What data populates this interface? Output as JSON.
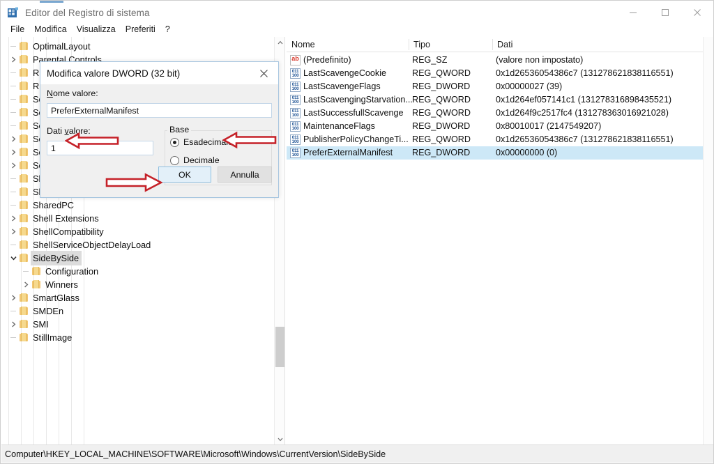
{
  "window": {
    "title": "Editor del Registro di sistema",
    "app_icon": "registry-editor-icon",
    "minimize_label": "Riduci a icona",
    "maximize_label": "Ingrandisci",
    "close_label": "Chiudi"
  },
  "menubar": {
    "items": [
      {
        "label": "File"
      },
      {
        "label": "Modifica"
      },
      {
        "label": "Visualizza"
      },
      {
        "label": "Preferiti"
      },
      {
        "label": "?"
      }
    ]
  },
  "tree": {
    "nodes": [
      {
        "label": "OptimalLayout",
        "depth": 6,
        "expander": "none",
        "selected": false
      },
      {
        "label": "Parental Controls",
        "depth": 6,
        "expander": "collapsed",
        "selected": false
      },
      {
        "label": "Run",
        "depth": 6,
        "expander": "none",
        "selected": false
      },
      {
        "label": "RunOnce",
        "depth": 6,
        "expander": "none",
        "selected": false
      },
      {
        "label": "Search",
        "depth": 6,
        "expander": "none",
        "selected": false
      },
      {
        "label": "SecondaryAuthFactor",
        "depth": 6,
        "expander": "none",
        "selected": false
      },
      {
        "label": "SecureAssessment",
        "depth": 6,
        "expander": "none",
        "selected": false
      },
      {
        "label": "Security and Maintenance",
        "depth": 6,
        "expander": "collapsed",
        "selected": false
      },
      {
        "label": "SettingSync",
        "depth": 6,
        "expander": "collapsed",
        "selected": false
      },
      {
        "label": "Setup",
        "depth": 6,
        "expander": "collapsed",
        "selected": false
      },
      {
        "label": "SharedAccess",
        "depth": 6,
        "expander": "none",
        "selected": false
      },
      {
        "label": "SharedDLLs",
        "depth": 6,
        "expander": "none",
        "selected": false
      },
      {
        "label": "SharedPC",
        "depth": 6,
        "expander": "none",
        "selected": false
      },
      {
        "label": "Shell Extensions",
        "depth": 6,
        "expander": "collapsed",
        "selected": false
      },
      {
        "label": "ShellCompatibility",
        "depth": 6,
        "expander": "collapsed",
        "selected": false
      },
      {
        "label": "ShellServiceObjectDelayLoad",
        "depth": 6,
        "expander": "none",
        "selected": false
      },
      {
        "label": "SideBySide",
        "depth": 6,
        "expander": "expanded",
        "selected": true
      },
      {
        "label": "Configuration",
        "depth": 7,
        "expander": "none",
        "selected": false
      },
      {
        "label": "Winners",
        "depth": 7,
        "expander": "collapsed",
        "selected": false
      },
      {
        "label": "SmartGlass",
        "depth": 6,
        "expander": "collapsed",
        "selected": false
      },
      {
        "label": "SMDEn",
        "depth": 6,
        "expander": "none",
        "selected": false
      },
      {
        "label": "SMI",
        "depth": 6,
        "expander": "collapsed",
        "selected": false
      },
      {
        "label": "StillImage",
        "depth": 6,
        "expander": "none",
        "selected": false
      }
    ]
  },
  "values": {
    "columns": [
      {
        "key": "name",
        "label": "Nome"
      },
      {
        "key": "type",
        "label": "Tipo"
      },
      {
        "key": "data",
        "label": "Dati"
      }
    ],
    "rows": [
      {
        "icon": "string-value-icon",
        "name": "(Predefinito)",
        "type": "REG_SZ",
        "data": "(valore non impostato)",
        "selected": false
      },
      {
        "icon": "binary-value-icon",
        "name": "LastScavengeCookie",
        "type": "REG_QWORD",
        "data": "0x1d26536054386c7 (131278621838116551)",
        "selected": false
      },
      {
        "icon": "binary-value-icon",
        "name": "LastScavengeFlags",
        "type": "REG_DWORD",
        "data": "0x00000027 (39)",
        "selected": false
      },
      {
        "icon": "binary-value-icon",
        "name": "LastScavengingStarvation...",
        "type": "REG_QWORD",
        "data": "0x1d264ef057141c1 (131278316898435521)",
        "selected": false
      },
      {
        "icon": "binary-value-icon",
        "name": "LastSuccessfullScavenge",
        "type": "REG_QWORD",
        "data": "0x1d264f9c2517fc4 (131278363016921028)",
        "selected": false
      },
      {
        "icon": "binary-value-icon",
        "name": "MaintenanceFlags",
        "type": "REG_DWORD",
        "data": "0x80010017 (2147549207)",
        "selected": false
      },
      {
        "icon": "binary-value-icon",
        "name": "PublisherPolicyChangeTi...",
        "type": "REG_QWORD",
        "data": "0x1d26536054386c7 (131278621838116551)",
        "selected": false
      },
      {
        "icon": "binary-value-icon",
        "name": "PreferExternalManifest",
        "type": "REG_DWORD",
        "data": "0x00000000 (0)",
        "selected": true
      }
    ]
  },
  "statusbar": {
    "path": "Computer\\HKEY_LOCAL_MACHINE\\SOFTWARE\\Microsoft\\Windows\\CurrentVersion\\SideBySide"
  },
  "dialog": {
    "title": "Modifica valore DWORD (32 bit)",
    "close_label": "Chiudi",
    "name_label": "Nome valore:",
    "name_value": "PreferExternalManifest",
    "data_label_pre": "Dati ",
    "data_label_accel": "v",
    "data_label_post": "alore:",
    "data_value": "1",
    "base_group_label": "Base",
    "base_options": [
      {
        "label": "Esadecimale",
        "selected": true
      },
      {
        "label": "Decimale",
        "selected": false
      }
    ],
    "ok_label": "OK",
    "cancel_label": "Annulla"
  },
  "annotations": {
    "arrow_color": "#c52128",
    "items": [
      {
        "name": "arrow-to-value-field",
        "direction": "left"
      },
      {
        "name": "arrow-to-hex-radio",
        "direction": "left"
      },
      {
        "name": "arrow-to-ok-button",
        "direction": "right"
      }
    ]
  },
  "colors": {
    "selection_blue": "#cde8f7",
    "tree_selection_gray": "#dcdcdc",
    "folder_yellow": "#f2c674",
    "annotation_red": "#c52128",
    "dialog_border": "#a8c6e0"
  }
}
